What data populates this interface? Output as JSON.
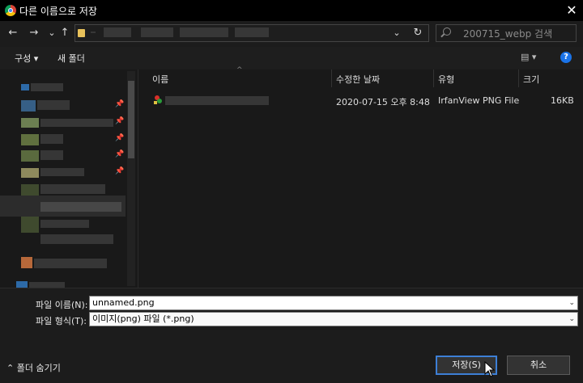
{
  "window": {
    "title": "다른 이름으로 저장",
    "close": "✕"
  },
  "nav": {
    "back": "←",
    "forward": "→",
    "dropdown": "⌄",
    "up": "↑",
    "refresh": "↻",
    "addr_dropdown": "⌄"
  },
  "search": {
    "placeholder": "200715_webp 검색"
  },
  "commands": {
    "organize": "구성 ▾",
    "new_folder": "새 폴더",
    "view": "▤ ▾",
    "help": "?"
  },
  "file_list": {
    "sort_indicator": "^",
    "columns": [
      "이름",
      "수정한 날짜",
      "유형",
      "크기"
    ],
    "rows": [
      {
        "name": "",
        "modified": "2020-07-15 오후 8:48",
        "type": "IrfanView PNG File",
        "size": "16KB"
      }
    ]
  },
  "form": {
    "filename_label": "파일 이름(N):",
    "filename_value": "unnamed.png",
    "filetype_label": "파일 형식(T):",
    "filetype_value": "이미지(png) 파일 (*.png)"
  },
  "footer": {
    "hide_folders": "⌃ 폴더 숨기기",
    "save": "저장(S)",
    "cancel": "취소"
  },
  "colors": {
    "accent": "#3d7fd6",
    "help": "#1a73e8",
    "folder": "#e8c15a"
  }
}
